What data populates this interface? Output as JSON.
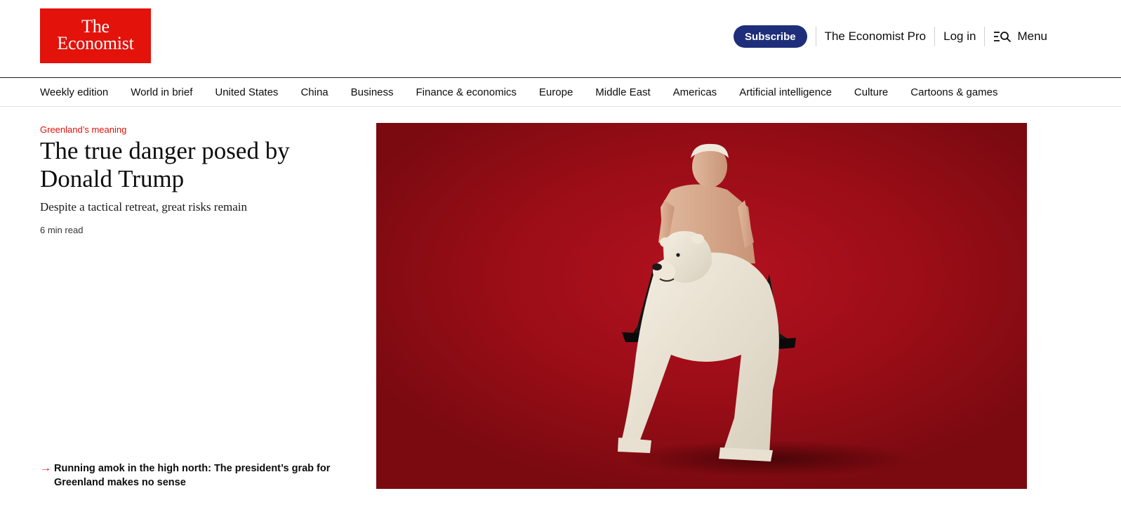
{
  "brand": {
    "line1": "The",
    "line2": "Economist"
  },
  "header": {
    "subscribe_label": "Subscribe",
    "pro_label": "The Economist Pro",
    "login_label": "Log in",
    "menu_label": "Menu"
  },
  "nav": {
    "items": [
      "Weekly edition",
      "World in brief",
      "United States",
      "China",
      "Business",
      "Finance & economics",
      "Europe",
      "Middle East",
      "Americas",
      "Artificial intelligence",
      "Culture",
      "Cartoons & games"
    ]
  },
  "lead": {
    "kicker": "Greenland’s meaning",
    "headline": "The true danger posed by Donald Trump",
    "rubric": "Despite a tactical retreat, great risks remain",
    "read_time": "6 min read",
    "related": "Running amok in the high north: The president’s grab for Greenland makes no sense"
  },
  "colors": {
    "brand_red": "#e3120b",
    "subscribe_blue": "#1f2e7a",
    "hero_red": "#9c0d17"
  }
}
